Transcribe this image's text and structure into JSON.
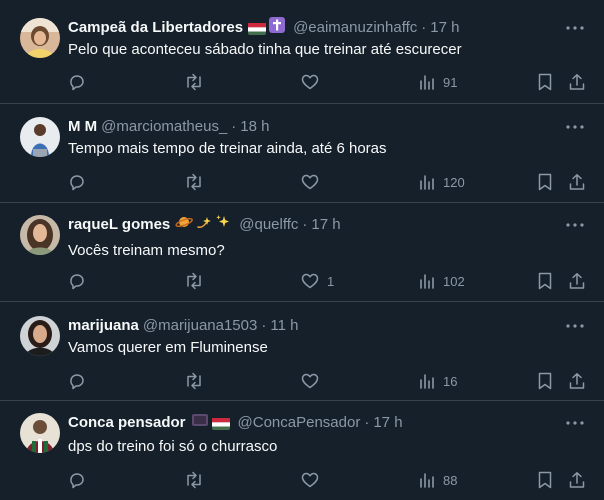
{
  "tweets": [
    {
      "name": "Campeã da Libertadores",
      "badges": [
        "hungary-flag",
        "cross-emoji"
      ],
      "handle": "@eaimanuzinhaffc",
      "time": "17 h",
      "text": "Pelo que aconteceu sábado tinha que treinar até escurecer",
      "likes": "",
      "views": "91"
    },
    {
      "name": "M M",
      "badges": [],
      "handle": "@marciomatheus_",
      "time": "18 h",
      "text": "Tempo mais tempo de treinar ainda, até 6 horas",
      "likes": "",
      "views": "120"
    },
    {
      "name": "raqueL gomes",
      "badges": [
        "saturn-emoji",
        "dizzy-emoji",
        "sparkles-emoji"
      ],
      "handle": "@quelffc",
      "time": "17 h",
      "text": "Vocês treinam mesmo?",
      "likes": "1",
      "views": "102"
    },
    {
      "name": "marijuana",
      "badges": [],
      "handle": "@marijuana1503",
      "time": "11 h",
      "text": "Vamos querer em Fluminense",
      "likes": "",
      "views": "16"
    },
    {
      "name": "Conca pensador",
      "badges": [
        "tv-emoji",
        "hungary-flag"
      ],
      "handle": "@ConcaPensador",
      "time": "17 h",
      "text": "dps do treino foi só o churrasco",
      "likes": "",
      "views": "88"
    }
  ],
  "colors": {
    "background": "#15202b",
    "divider": "#38444d",
    "secondary_text": "#8b98a5",
    "primary_text": "#f7f9f9"
  }
}
